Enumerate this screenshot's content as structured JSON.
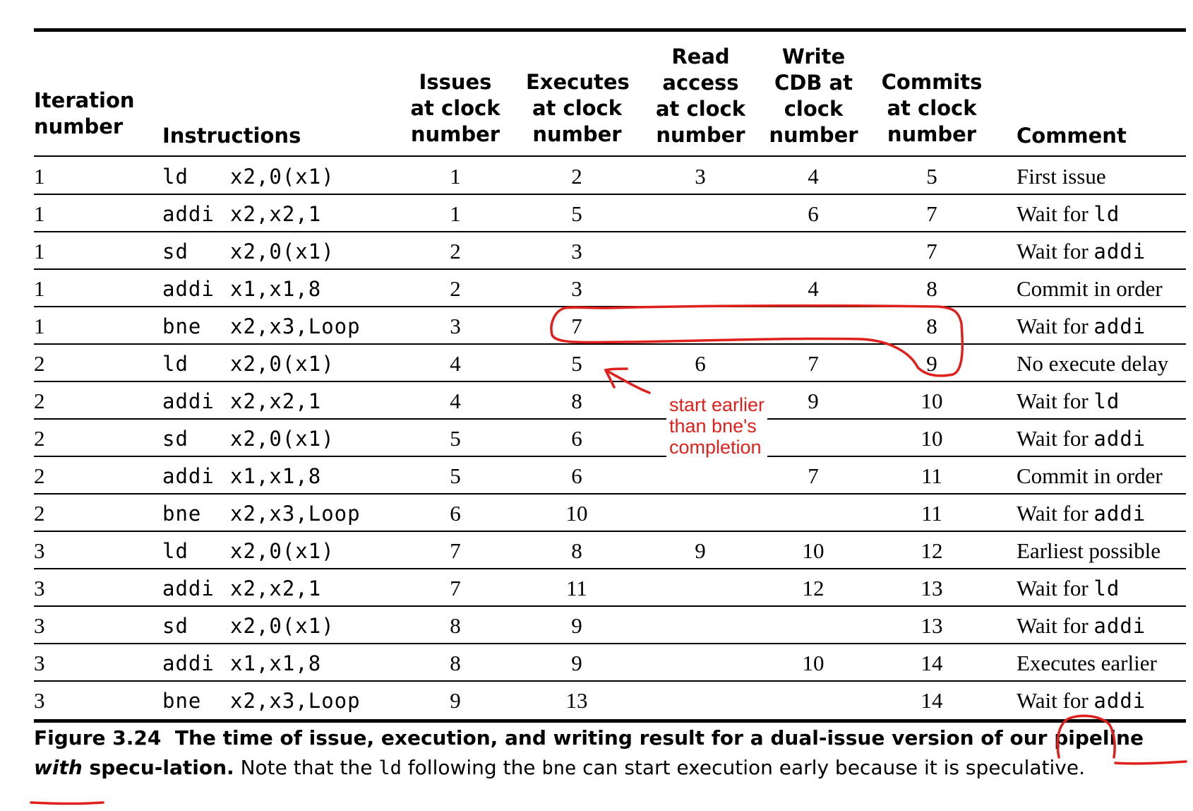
{
  "table": {
    "headers": {
      "iteration": "Iteration\nnumber",
      "instructions": "Instructions",
      "issues": "Issues\nat clock\nnumber",
      "executes": "Executes\nat clock\nnumber",
      "read": "Read\naccess\nat clock\nnumber",
      "write": "Write\nCDB at\nclock\nnumber",
      "commits": "Commits\nat clock\nnumber",
      "comment": "Comment"
    },
    "rows": [
      {
        "iter": "1",
        "op": "ld",
        "args": "x2,0(x1)",
        "issue": "1",
        "exec": "2",
        "read": "3",
        "write": "4",
        "commit": "5",
        "comment_text": "First issue",
        "comment_code": ""
      },
      {
        "iter": "1",
        "op": "addi",
        "args": "x2,x2,1",
        "issue": "1",
        "exec": "5",
        "read": "",
        "write": "6",
        "commit": "7",
        "comment_text": "Wait for ",
        "comment_code": "ld"
      },
      {
        "iter": "1",
        "op": "sd",
        "args": "x2,0(x1)",
        "issue": "2",
        "exec": "3",
        "read": "",
        "write": "",
        "commit": "7",
        "comment_text": "Wait for ",
        "comment_code": "addi"
      },
      {
        "iter": "1",
        "op": "addi",
        "args": "x1,x1,8",
        "issue": "2",
        "exec": "3",
        "read": "",
        "write": "4",
        "commit": "8",
        "comment_text": "Commit in order",
        "comment_code": ""
      },
      {
        "iter": "1",
        "op": "bne",
        "args": "x2,x3,Loop",
        "issue": "3",
        "exec": "7",
        "read": "",
        "write": "",
        "commit": "8",
        "comment_text": "Wait for ",
        "comment_code": "addi"
      },
      {
        "iter": "2",
        "op": "ld",
        "args": "x2,0(x1)",
        "issue": "4",
        "exec": "5",
        "read": "6",
        "write": "7",
        "commit": "9",
        "comment_text": "No execute delay",
        "comment_code": ""
      },
      {
        "iter": "2",
        "op": "addi",
        "args": "x2,x2,1",
        "issue": "4",
        "exec": "8",
        "read": "",
        "write": "9",
        "commit": "10",
        "comment_text": "Wait for ",
        "comment_code": "ld"
      },
      {
        "iter": "2",
        "op": "sd",
        "args": "x2,0(x1)",
        "issue": "5",
        "exec": "6",
        "read": "",
        "write": "",
        "commit": "10",
        "comment_text": "Wait for ",
        "comment_code": "addi"
      },
      {
        "iter": "2",
        "op": "addi",
        "args": "x1,x1,8",
        "issue": "5",
        "exec": "6",
        "read": "",
        "write": "7",
        "commit": "11",
        "comment_text": "Commit in order",
        "comment_code": ""
      },
      {
        "iter": "2",
        "op": "bne",
        "args": "x2,x3,Loop",
        "issue": "6",
        "exec": "10",
        "read": "",
        "write": "",
        "commit": "11",
        "comment_text": "Wait for ",
        "comment_code": "addi"
      },
      {
        "iter": "3",
        "op": "ld",
        "args": "x2,0(x1)",
        "issue": "7",
        "exec": "8",
        "read": "9",
        "write": "10",
        "commit": "12",
        "comment_text": "Earliest possible",
        "comment_code": ""
      },
      {
        "iter": "3",
        "op": "addi",
        "args": "x2,x2,1",
        "issue": "7",
        "exec": "11",
        "read": "",
        "write": "12",
        "commit": "13",
        "comment_text": "Wait for ",
        "comment_code": "ld"
      },
      {
        "iter": "3",
        "op": "sd",
        "args": "x2,0(x1)",
        "issue": "8",
        "exec": "9",
        "read": "",
        "write": "",
        "commit": "13",
        "comment_text": "Wait for ",
        "comment_code": "addi"
      },
      {
        "iter": "3",
        "op": "addi",
        "args": "x1,x1,8",
        "issue": "8",
        "exec": "9",
        "read": "",
        "write": "10",
        "commit": "14",
        "comment_text": "Executes earlier",
        "comment_code": ""
      },
      {
        "iter": "3",
        "op": "bne",
        "args": "x2,x3,Loop",
        "issue": "9",
        "exec": "13",
        "read": "",
        "write": "",
        "commit": "14",
        "comment_text": "Wait for ",
        "comment_code": "addi"
      }
    ]
  },
  "caption": {
    "figure_label": "Figure 3.24",
    "title_pre": "The time of issue, execution, and writing result for a dual-issue version of our pipeline ",
    "title_em": "with",
    "title_post": " specu-lation.",
    "body_pre": "Note that the ",
    "code1": "ld",
    "body_mid": " following the ",
    "code2": "bne",
    "body_post": " can start execution early because it is speculative."
  },
  "annotation": {
    "note_line1": "start earlier",
    "note_line2": "than bne's",
    "note_line3": "completion",
    "ink_color": "#e0201c"
  }
}
